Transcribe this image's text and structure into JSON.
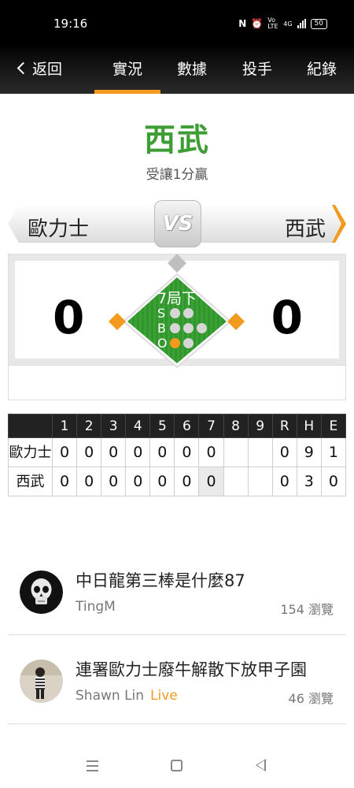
{
  "status_bar": {
    "time": "19:16",
    "nfc": "N",
    "network": "Vo LTE",
    "signal_label": "4G",
    "battery": "50"
  },
  "nav": {
    "back_label": "返回",
    "tabs": [
      {
        "label": "實況",
        "active": true
      },
      {
        "label": "數據",
        "active": false
      },
      {
        "label": "投手",
        "active": false
      },
      {
        "label": "紀錄",
        "active": false
      }
    ]
  },
  "result": {
    "winner": "西武",
    "subtitle": "受讓1分贏"
  },
  "matchup": {
    "away_team": "歐力士",
    "home_team": "西武",
    "vs_label": "VS"
  },
  "score": {
    "away": "0",
    "home": "0",
    "inning": "7局下",
    "sbo": {
      "S_label": "S",
      "B_label": "B",
      "O_label": "O",
      "strikes": 0,
      "balls": 0,
      "outs": 1
    }
  },
  "linescore": {
    "headers": [
      "",
      "1",
      "2",
      "3",
      "4",
      "5",
      "6",
      "7",
      "8",
      "9",
      "R",
      "H",
      "E"
    ],
    "rows": [
      {
        "team": "歐力士",
        "innings": [
          "0",
          "0",
          "0",
          "0",
          "0",
          "0",
          "0",
          "",
          ""
        ],
        "R": "0",
        "H": "9",
        "E": "1"
      },
      {
        "team": "西武",
        "innings": [
          "0",
          "0",
          "0",
          "0",
          "0",
          "0",
          "0",
          "",
          ""
        ],
        "R": "0",
        "H": "3",
        "E": "0"
      }
    ]
  },
  "posts": [
    {
      "title": "中日龍第三棒是什麼87",
      "author": "TingM",
      "live": "",
      "views": "154 瀏覽",
      "avatar_icon": "skull-avatar-icon"
    },
    {
      "title": "連署歐力士廢牛解散下放甲子園",
      "author": "Shawn Lin",
      "live": "Live",
      "views": "46 瀏覽",
      "avatar_icon": "person-photo-avatar-icon"
    }
  ],
  "colors": {
    "accent": "#f29a1d",
    "field_green": "#3f9d35",
    "winner_green": "#3f9d35"
  }
}
